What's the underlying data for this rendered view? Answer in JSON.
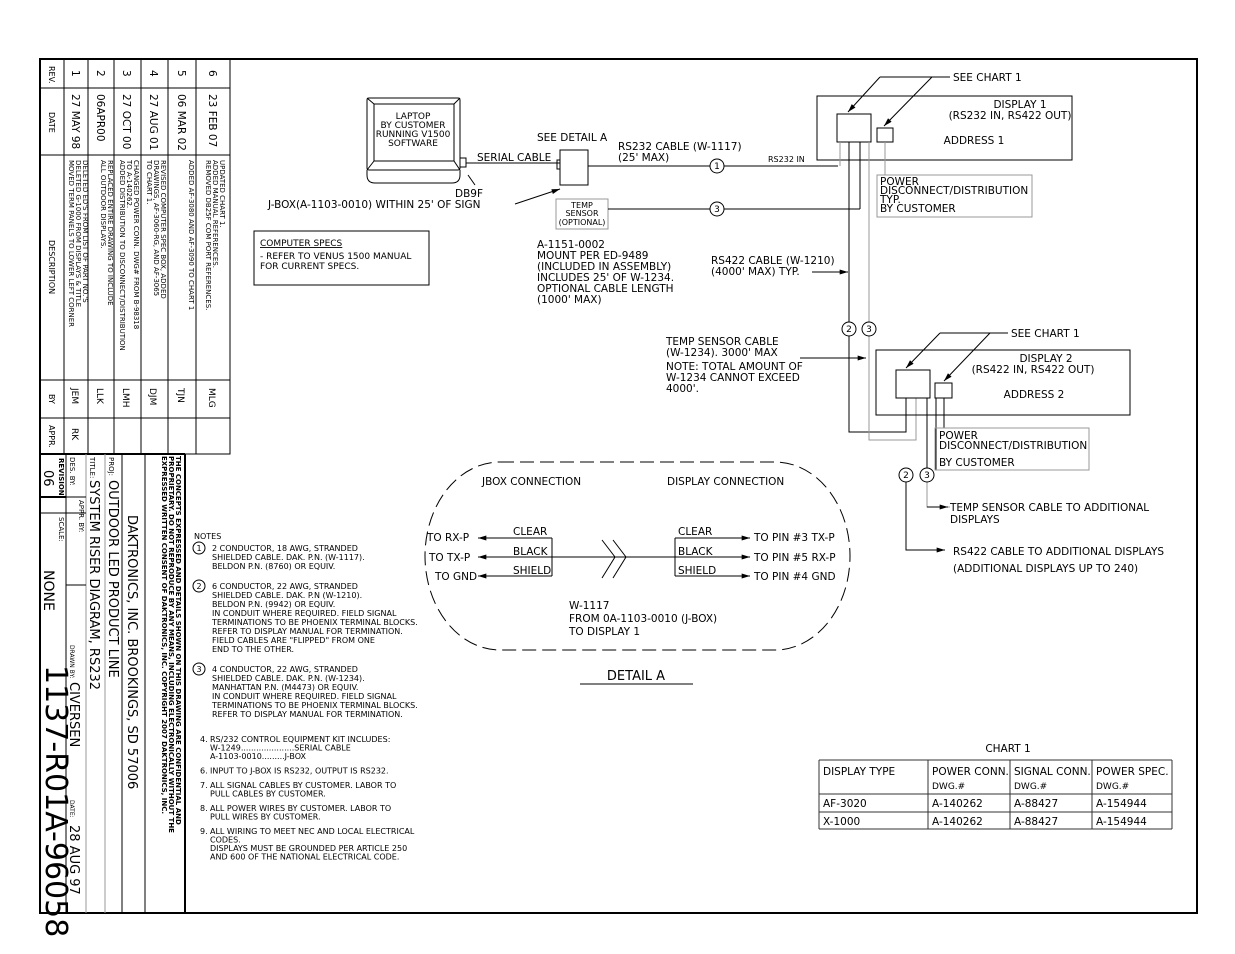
{
  "revision_block": {
    "headers": {
      "rev": "REV.",
      "date": "DATE",
      "description": "DESCRIPTION",
      "by": "BY",
      "appr": "APPR."
    },
    "rows": [
      {
        "rev": "1",
        "date": "27 MAY 98",
        "description": [
          "DELETED ED'S FROM LIST OF PART NO.'S",
          "DELETED G-1000 FROM DISPLAYS & TITLE",
          "MOVED TERM PANELS TO LOWER LEFT CORNER"
        ],
        "by": "JEM",
        "appr": "RK"
      },
      {
        "rev": "2",
        "date": "06APR00",
        "description": [
          "REPLACED ENTIRE DRAWING TO INCLUDE",
          "ALL OUTDOOR DISPLAYS."
        ],
        "by": "LLK",
        "appr": ""
      },
      {
        "rev": "3",
        "date": "27 OCT 00",
        "description": [
          "CHANGED POWER CONN. DWG# FROM B-98318",
          "TO A-140262.",
          "ADDED DISTRIBUTION TO DISCONNECT/DISTRIBUTION"
        ],
        "by": "LMH",
        "appr": ""
      },
      {
        "rev": "4",
        "date": "27 AUG 01",
        "description": [
          "REVISED COMPUTER SPEC BOX, ADDED",
          "DRAWINGS, AF-3060-RG, AND AF-3065",
          "TO CHART 1."
        ],
        "by": "DJM",
        "appr": ""
      },
      {
        "rev": "5",
        "date": "06 MAR 02",
        "description": [
          "ADDED AF-3080 AND AF-3090 TO CHART 1"
        ],
        "by": "TJN",
        "appr": ""
      },
      {
        "rev": "6",
        "date": "23 FEB 07",
        "description": [
          "UPDATED CHART 1.",
          "ADDED MANUAL REFERENCES.",
          "REMOVED DB25F COM PORT REFERENCES."
        ],
        "by": "MLG",
        "appr": ""
      }
    ]
  },
  "title_block": {
    "confidential": [
      "THE CONCEPTS EXPRESSED AND DETAILS SHOWN ON THIS DRAWING ARE CONFIDENTIAL AND",
      "PROPRIETARY. DO NOT REPRODUCE BY ANY MEANS, INCLUDING ELECTRONICALLY WITHOUT THE",
      "EXPRESSED WRITTEN CONSENT OF DAKTRONICS, INC.                    COPYRIGHT 2007 DAKTRONICS, INC."
    ],
    "company": "DAKTRONICS, INC.   BROOKINGS, SD 57006",
    "proj_label": "PROJ:",
    "proj": "OUTDOOR LED PRODUCT LINE",
    "title_label": "TITLE:",
    "title": "SYSTEM RISER DIAGRAM, RS232",
    "des_by_label": "DES. BY:",
    "drawn_by_label": "DRAWN BY:",
    "drawn_by": "CIVERSEN",
    "date_label": "DATE:",
    "date": "28 AUG 97",
    "revision_label": "REVISION",
    "revision": "06",
    "appr_by_label": "APPR. BY:",
    "scale_label": "SCALE:",
    "scale": "NONE",
    "drawing_number": "1137-R01A-96058"
  },
  "notes": {
    "heading": "NOTES",
    "items": [
      {
        "marker": "1",
        "lines": [
          "2 CONDUCTOR, 18 AWG, STRANDED",
          "SHIELDED CABLE. DAK. P.N. (W-1117).",
          "BELDON P.N. (8760) OR EQUIV."
        ]
      },
      {
        "marker": "2",
        "lines": [
          "6 CONDUCTOR, 22 AWG, STRANDED",
          "SHIELDED CABLE. DAK. P.N (W-1210).",
          "BELDON P.N. (9942) OR EQUIV.",
          "IN CONDUIT WHERE REQUIRED.  FIELD SIGNAL",
          "TERMINATIONS TO BE PHOENIX TERMINAL BLOCKS.",
          "REFER TO DISPLAY MANUAL FOR TERMINATION.",
          "FIELD CABLES ARE \"FLIPPED\" FROM ONE",
          "END TO THE OTHER."
        ]
      },
      {
        "marker": "3",
        "lines": [
          "4 CONDUCTOR, 22 AWG, STRANDED",
          "SHIELDED CABLE. DAK. P.N. (W-1234).",
          "MANHATTAN P.N. (M4473) OR EQUIV.",
          "IN CONDUIT WHERE REQUIRED.  FIELD SIGNAL",
          "TERMINATIONS TO BE PHOENIX TERMINAL BLOCKS.",
          "REFER TO DISPLAY MANUAL FOR TERMINATION."
        ]
      }
    ],
    "numbered": [
      {
        "num": "4.",
        "lines": [
          "RS/232 CONTROL EQUIPMENT KIT INCLUDES:",
          "   W-1249.....................SERIAL CABLE",
          "   A-1103-0010.........J-BOX"
        ]
      },
      {
        "num": "6.",
        "lines": [
          "INPUT TO J-BOX IS RS232, OUTPUT IS RS232."
        ]
      },
      {
        "num": "7.",
        "lines": [
          "ALL SIGNAL CABLES BY CUSTOMER. LABOR TO",
          "PULL CABLES BY CUSTOMER."
        ]
      },
      {
        "num": "8.",
        "lines": [
          "ALL POWER WIRES BY CUSTOMER. LABOR TO",
          "PULL WIRES BY CUSTOMER."
        ]
      },
      {
        "num": "9.",
        "lines": [
          "ALL WIRING TO MEET NEC AND LOCAL ELECTRICAL",
          "CODES.",
          "DISPLAYS MUST BE GROUNDED PER ARTICLE 250",
          "AND 600 OF THE NATIONAL ELECTRICAL CODE."
        ]
      }
    ]
  },
  "computer_specs": {
    "heading": "COMPUTER SPECS",
    "lines": [
      "-  REFER TO VENUS 1500 MANUAL",
      "   FOR CURRENT SPECS."
    ]
  },
  "diagram": {
    "laptop": [
      "LAPTOP",
      "BY CUSTOMER",
      "RUNNING V1500",
      "SOFTWARE"
    ],
    "db9f": "DB9F",
    "serial_cable": "SERIAL  CABLE",
    "see_detail_a": "SEE  DETAIL  A",
    "jbox_label": "J-BOX(A-1103-0010)  WITHIN  25'  OF  SIGN",
    "rs232_cable": [
      "RS232  CABLE  (W-1117)",
      "(25'  MAX)"
    ],
    "rs232_in": "RS232  IN",
    "temp_sensor": [
      "TEMP",
      "SENSOR",
      "(OPTIONAL)"
    ],
    "temp_mount": [
      "A-1151-0002",
      "MOUNT PER ED-9489",
      "(INCLUDED IN ASSEMBLY)",
      "INCLUDES 25' OF W-1234.",
      "OPTIONAL CABLE LENGTH",
      "(1000' MAX)"
    ],
    "rs422_cable": [
      "RS422  CABLE  (W-1210)",
      "(4000'  MAX)  TYP."
    ],
    "see_chart_1": "SEE  CHART  1",
    "display1": [
      "DISPLAY  1",
      "(RS232  IN,  RS422  OUT)",
      "ADDRESS  1"
    ],
    "power1": [
      "POWER",
      "DISCONNECT/DISTRIBUTION",
      "TYP.",
      "BY  CUSTOMER"
    ],
    "temp_sensor_cable": [
      "TEMP  SENSOR  CABLE",
      "(W-1234).  3000'  MAX",
      "NOTE:  TOTAL  AMOUNT  OF",
      "W-1234  CANNOT  EXCEED",
      "4000'."
    ],
    "display2": [
      "DISPLAY  2",
      "(RS422  IN,  RS422  OUT)",
      "ADDRESS  2"
    ],
    "power2": [
      "POWER",
      "DISCONNECT/DISTRIBUTION",
      "BY  CUSTOMER"
    ],
    "to_additional_temp": [
      "TEMP  SENSOR  CABLE  TO  ADDITIONAL",
      "DISPLAYS"
    ],
    "to_additional_rs422": [
      "RS422  CABLE  TO  ADDITIONAL  DISPLAYS",
      "(ADDITIONAL  DISPLAYS  UP  TO  240)"
    ],
    "markers": {
      "one": "1",
      "two": "2",
      "three": "3"
    }
  },
  "detail_a": {
    "title": "DETAIL  A",
    "jbox_heading": "JBOX  CONNECTION",
    "display_heading": "DISPLAY  CONNECTION",
    "left_targets": [
      "TO  RX-P",
      "TO  TX-P",
      "TO  GND"
    ],
    "wire_colors": [
      "CLEAR",
      "BLACK",
      "SHIELD"
    ],
    "right_targets": [
      "TO  PIN  #3  TX-P",
      "TO  PIN  #5  RX-P",
      "TO  PIN  #4  GND"
    ],
    "cable_note": [
      "W-1117",
      "FROM  0A-1103-0010  (J-BOX)",
      "TO  DISPLAY  1"
    ]
  },
  "chart1": {
    "title": "CHART  1",
    "headers": [
      [
        "DISPLAY  TYPE",
        ""
      ],
      [
        "POWER  CONN.",
        "DWG.#"
      ],
      [
        "SIGNAL  CONN.",
        "DWG.#"
      ],
      [
        "POWER  SPEC.",
        "DWG.#"
      ]
    ],
    "rows": [
      [
        "AF-3020",
        "A-140262",
        "A-88427",
        "A-154944"
      ],
      [
        "X-1000",
        "A-140262",
        "A-88427",
        "A-154944"
      ]
    ]
  }
}
